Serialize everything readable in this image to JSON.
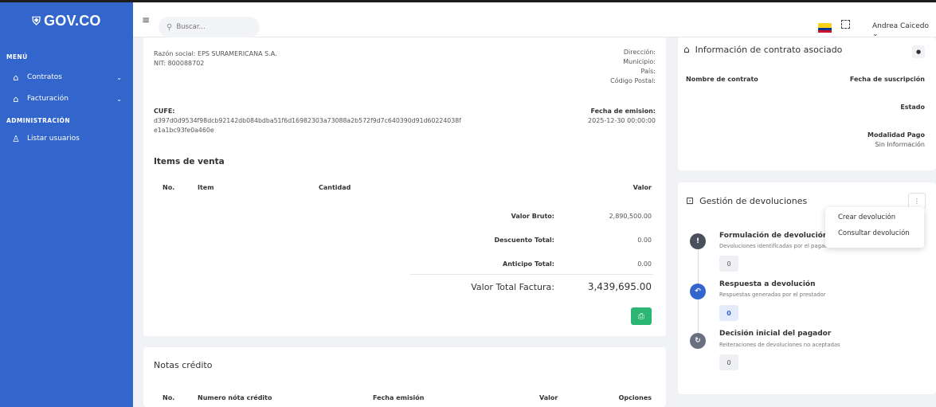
{
  "brand": {
    "logo_text": "GOV.CO"
  },
  "sidebar": {
    "section_menu": "MENÚ",
    "items": [
      {
        "label": "Contratos"
      },
      {
        "label": "Facturación"
      }
    ],
    "section_admin": "ADMINISTRACIÓN",
    "admin_items": [
      {
        "label": "Listar usuarios"
      }
    ]
  },
  "topbar": {
    "search_placeholder": "Buscar...",
    "user_name": "Andrea Caicedo"
  },
  "invoice": {
    "razon_social": "Razón social: EPS SURAMERICANA S.A.",
    "nit": "NIT: 800088702",
    "direccion_label": "Dirección:",
    "municipio_label": "Municipio:",
    "pais_label": "País:",
    "codigo_postal_label": "Código Postal:",
    "cufe_label": "CUFE:",
    "cufe_line1": "d397d0d9534f98dcb92142db084bdba51f6d16982303a73088a2b572f9d7c640390d91d60224038f",
    "cufe_line2": "e1a1bc93fe0a460e",
    "fecha_emision_label": "Fecha de emision:",
    "fecha_emision_value": "2025-12-30 00:00:00",
    "items_title": "Items de venta",
    "columns": {
      "no": "No.",
      "item": "Item",
      "cantidad": "Cantidad",
      "valor": "Valor"
    },
    "totals": {
      "bruto_label": "Valor Bruto:",
      "bruto_value": "2,890,500.00",
      "descuento_label": "Descuento Total:",
      "descuento_value": "0.00",
      "anticipo_label": "Anticipo Total:",
      "anticipo_value": "0.00",
      "total_label": "Valor Total Factura:",
      "total_value": "3,439,695.00"
    }
  },
  "notas": {
    "title": "Notas crédito",
    "columns": {
      "no": "No.",
      "numero": "Numero nóta crédito",
      "fecha": "Fecha emisión",
      "valor": "Valor",
      "opciones": "Opciones"
    }
  },
  "contract": {
    "title": "Información de contrato asociado",
    "nombre_label": "Nombre de contrato",
    "fecha_label": "Fecha de suscripción",
    "estado_label": "Estado",
    "modalidad_label": "Modalidad Pago",
    "modalidad_value": "Sin Información"
  },
  "devoluciones": {
    "title": "Gestión de devoluciones",
    "steps": [
      {
        "title": "Formulación de devolución",
        "subtitle": "Devoluciones identificadas por el pagador",
        "count": "0"
      },
      {
        "title": "Respuesta a devolución",
        "subtitle": "Respuestas generadas por el prestador",
        "count": "0"
      },
      {
        "title": "Decisión inicial del pagador",
        "subtitle": "Reiteraciones de devoluciones no aceptadas",
        "count": "0"
      }
    ],
    "menu": [
      {
        "label": "Crear devolución"
      },
      {
        "label": "Consultar devolución"
      }
    ]
  },
  "colors": {
    "sidebar": "#3366cc",
    "print_button": "#2bb673",
    "step1": "#4a4f5c",
    "step2": "#3366cc",
    "step3": "#6b7080"
  }
}
